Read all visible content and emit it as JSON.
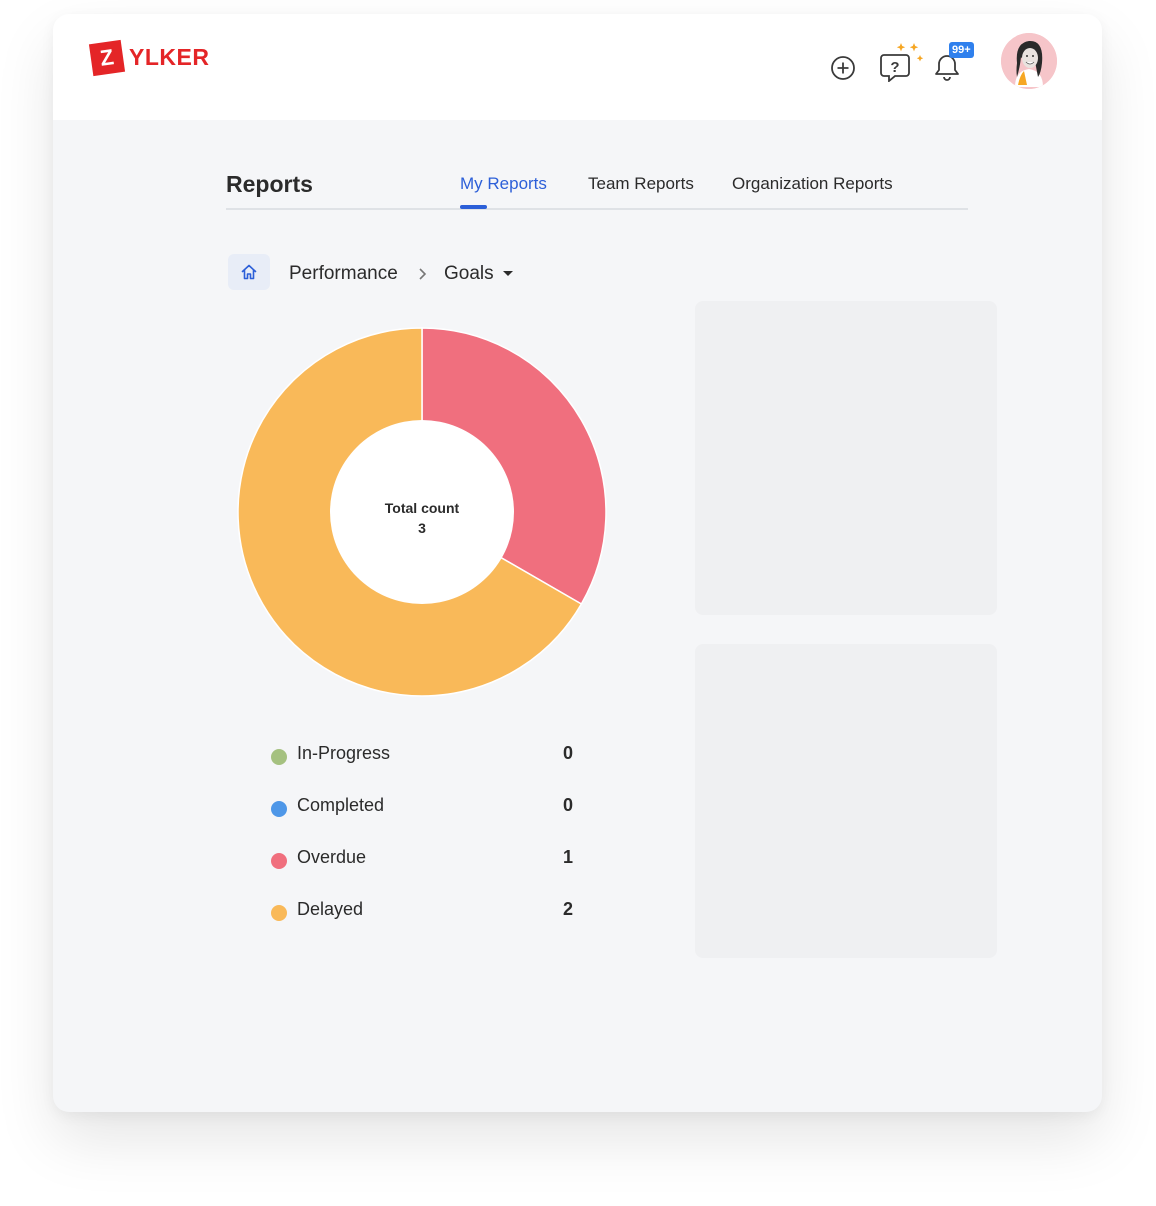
{
  "brand": {
    "logo_letter": "Z",
    "logo_rest": "YLKER",
    "color": "#e42527"
  },
  "header": {
    "add_icon": "plus-circle-icon",
    "help_icon": "ai-help-icon",
    "bell_icon": "bell-icon",
    "notification_count": "99+"
  },
  "page": {
    "title": "Reports",
    "tabs": [
      {
        "label": "My Reports",
        "active": true
      },
      {
        "label": "Team Reports",
        "active": false
      },
      {
        "label": "Organization Reports",
        "active": false
      }
    ],
    "accent": "#2c5fd8"
  },
  "breadcrumb": {
    "home_icon": "home-icon",
    "items": [
      "Performance",
      "Goals"
    ]
  },
  "chart_data": {
    "type": "pie",
    "variant": "donut",
    "center_label": "Total count",
    "center_value": "3",
    "slices": [
      {
        "label": "In-Progress",
        "value": 0,
        "color": "#a5c180"
      },
      {
        "label": "Completed",
        "value": 0,
        "color": "#4e97e8"
      },
      {
        "label": "Overdue",
        "value": 1,
        "color": "#f06f7e"
      },
      {
        "label": "Delayed",
        "value": 2,
        "color": "#f9b959"
      }
    ]
  },
  "legend": [
    {
      "label": "In-Progress",
      "value": "0",
      "color": "#a5c180"
    },
    {
      "label": "Completed",
      "value": "0",
      "color": "#4e97e8"
    },
    {
      "label": "Overdue",
      "value": "1",
      "color": "#f06f7e"
    },
    {
      "label": "Delayed",
      "value": "2",
      "color": "#f9b959"
    }
  ]
}
